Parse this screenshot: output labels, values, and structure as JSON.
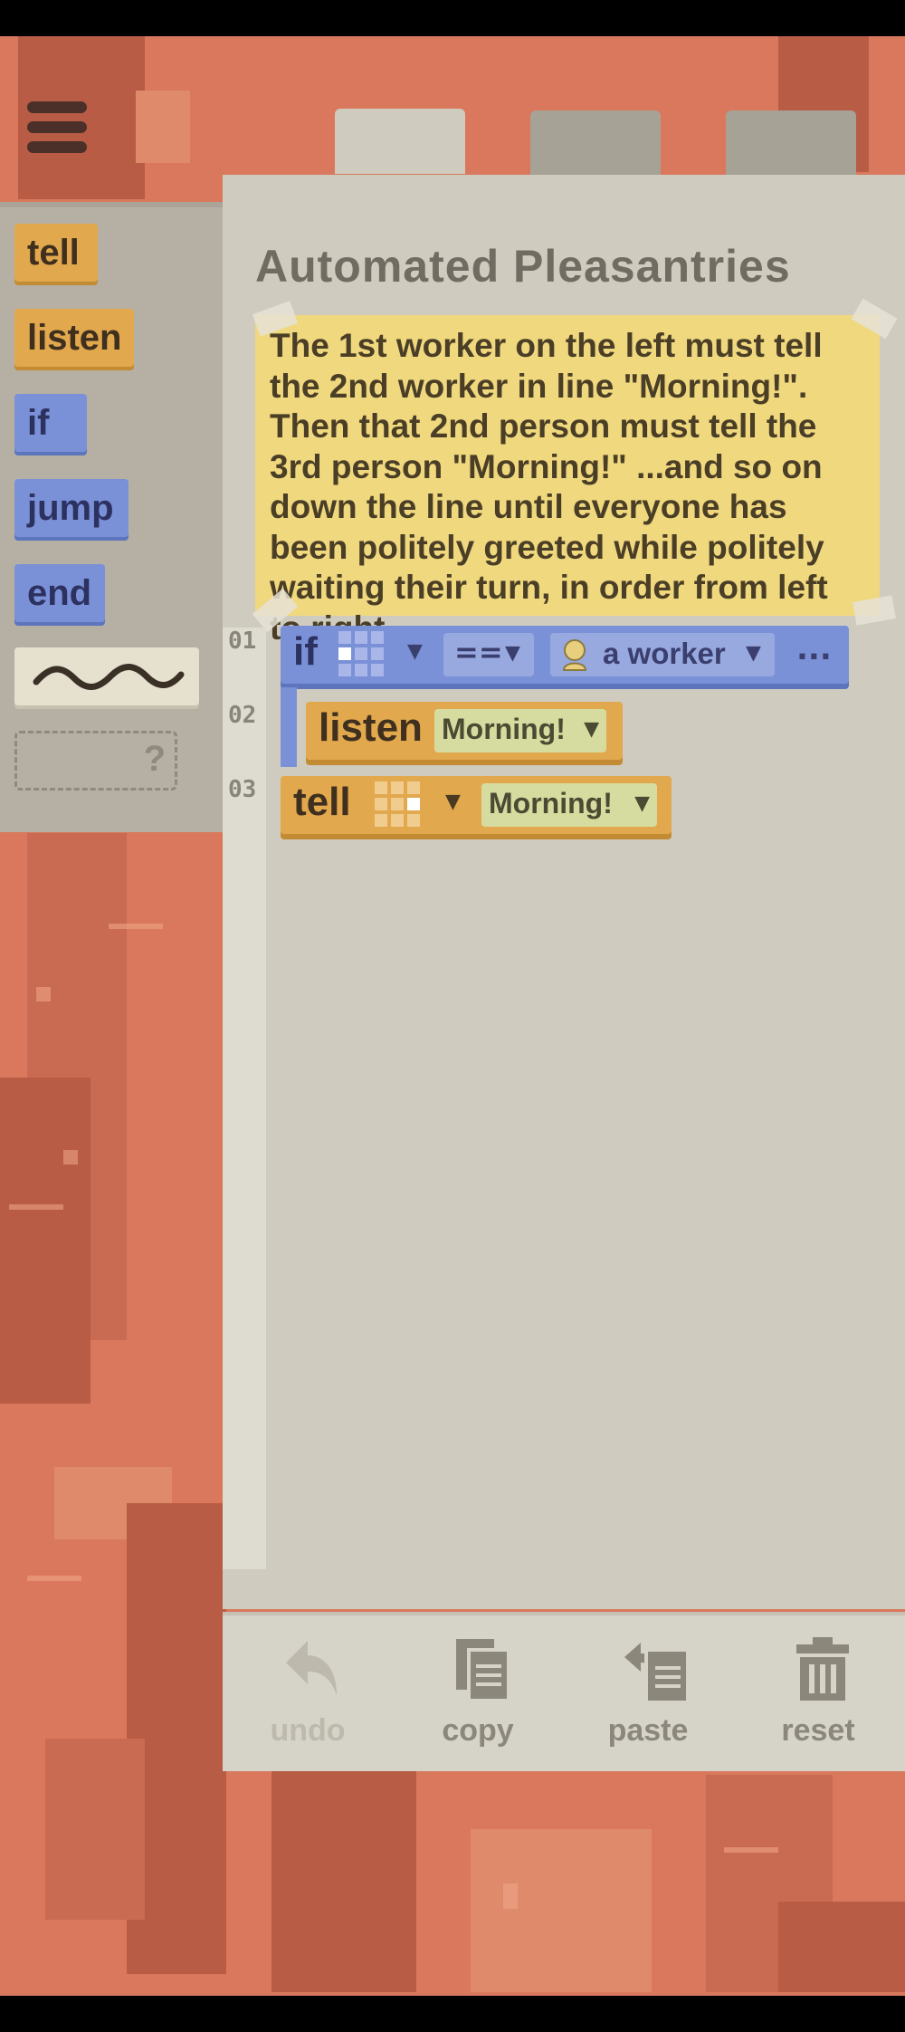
{
  "menu": {
    "icon": "hamburger-menu-icon"
  },
  "palette": {
    "blocks": [
      {
        "label": "tell",
        "color": "#e1a84e"
      },
      {
        "label": "listen",
        "color": "#e1a84e"
      },
      {
        "label": "if",
        "color": "#7a91d8"
      },
      {
        "label": "jump",
        "color": "#7a91d8"
      },
      {
        "label": "end",
        "color": "#7a91d8"
      }
    ],
    "comment_icon": "squiggle-comment-icon",
    "define_placeholder": "?"
  },
  "level": {
    "title": "Automated Pleasantries",
    "description": "The 1st worker on the left must tell the 2nd worker in line \"Morning!\". Then that 2nd person must tell the 3rd person \"Morning!\" ...and so on down the line until everyone has been politely greeted while politely waiting their turn, in order from left to right."
  },
  "code": {
    "line_numbers": [
      "01",
      "02",
      "03"
    ],
    "if_line": {
      "keyword": "if",
      "operator": "==",
      "target": "a worker",
      "more": "..."
    },
    "listen_line": {
      "keyword": "listen",
      "message": "Morning!"
    },
    "tell_line": {
      "keyword": "tell",
      "message": "Morning!"
    }
  },
  "toolbar": {
    "undo": "undo",
    "copy": "copy",
    "paste": "paste",
    "reset": "reset"
  },
  "colors": {
    "background": "#d9785c",
    "panel": "#cfccbf",
    "note": "#f0d87e",
    "yellow_block": "#e1a84e",
    "blue_block": "#7a91d8"
  }
}
